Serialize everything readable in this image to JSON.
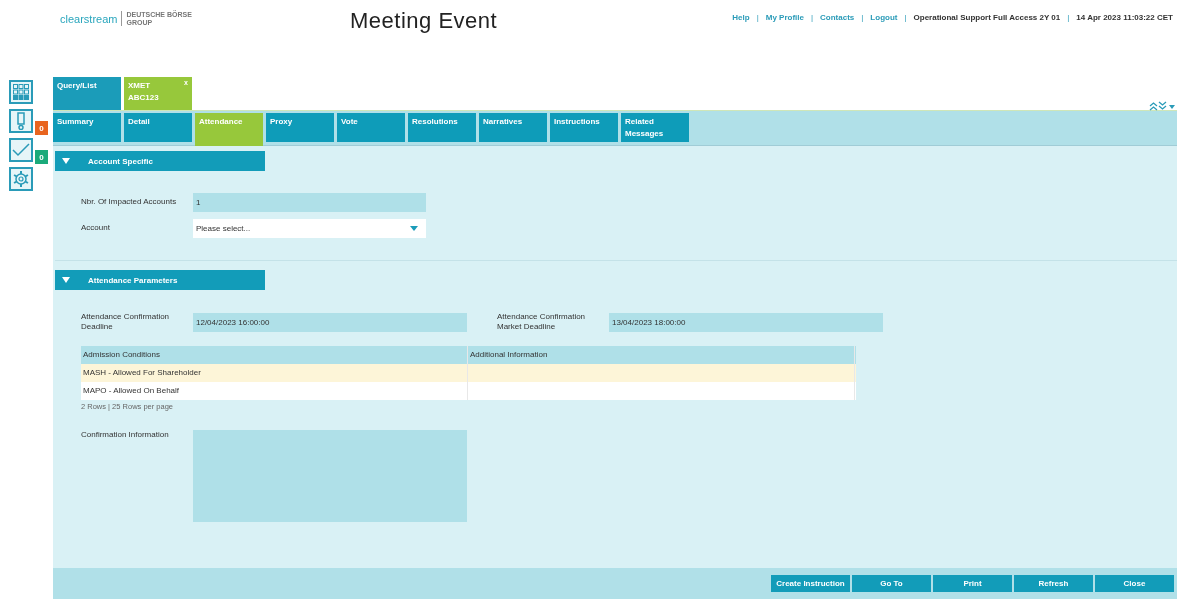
{
  "logo": {
    "brand": "clearstream",
    "group_line1": "DEUTSCHE BÖRSE",
    "group_line2": "GROUP"
  },
  "window": {
    "title": "Meeting Event"
  },
  "header_links": [
    "Help",
    "My Profile",
    "Contacts",
    "Logout"
  ],
  "separator": "|",
  "user": "Operational Support Full Access 2Y 01",
  "datetime": "14 Apr 2023 11:03:22 CET",
  "rail": [
    {
      "kind": "grid"
    },
    {
      "kind": "alert",
      "badge": "0",
      "color": "#e8641e"
    },
    {
      "kind": "check",
      "badge": "0",
      "color": "#1aaa7a"
    },
    {
      "kind": "settings"
    }
  ],
  "doc_tabs": [
    {
      "label": "Query/List",
      "selected": false
    },
    {
      "label": "XMET\nABC123",
      "selected": true,
      "close": "x"
    }
  ],
  "tabs": [
    {
      "label": "Summary",
      "selected": false
    },
    {
      "label": "Detail",
      "selected": false
    },
    {
      "label": "Attendance",
      "selected": true
    },
    {
      "label": "Proxy",
      "selected": false
    },
    {
      "label": "Vote",
      "selected": false
    },
    {
      "label": "Resolutions",
      "selected": false
    },
    {
      "label": "Narratives",
      "selected": false
    },
    {
      "label": "Instructions",
      "selected": false
    },
    {
      "label": "Related\nMessages",
      "selected": false
    }
  ],
  "account_section": {
    "title": "Account Specific",
    "expanded": true,
    "impacted_label": "Nbr. Of Impacted Accounts",
    "impacted_value": "1",
    "account_label": "Account",
    "account_placeholder": "Please select..."
  },
  "attendance_section": {
    "title": "Attendance Parameters",
    "expanded": true,
    "deadline_label": "Attendance Confirmation Deadline",
    "deadline_value": "12/04/2023 16:00:00",
    "market_label": "Attendance Confirmation Market Deadline",
    "market_value": "13/04/2023 18:00:00",
    "table": {
      "columns": [
        "Admission Conditions",
        "Additional Information"
      ],
      "rows": [
        {
          "cells": [
            "MASH - Allowed For Shareholder",
            ""
          ],
          "selected": true
        },
        {
          "cells": [
            "MAPO - Allowed On Behalf",
            ""
          ],
          "selected": false
        }
      ],
      "footer": "2 Rows | 25 Rows per page"
    },
    "confirmation_label": "Confirmation Information"
  },
  "buttons": [
    "Create Instruction",
    "Go To",
    "Print",
    "Refresh",
    "Close"
  ]
}
